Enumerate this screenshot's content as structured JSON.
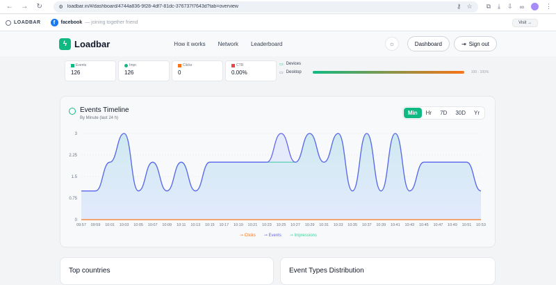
{
  "browser": {
    "url": "loadbar.in/#/dashboard/4744a836-9f28-4df7-81dc-376737f7643d?tab=overview"
  },
  "notification": {
    "brand": "LOADBAR",
    "source": "facebook",
    "message": "— joining together friend",
    "visit_label": "Visit →"
  },
  "header": {
    "logo": "Loadbar",
    "nav": [
      "How it works",
      "Network",
      "Leaderboard"
    ],
    "dashboard_label": "Dashboard",
    "signout_label": "Sign out"
  },
  "stats": [
    {
      "label": "Events",
      "value": "126",
      "color": "#10b981"
    },
    {
      "label": "Impr.",
      "value": "126",
      "color": "#10b981"
    },
    {
      "label": "Clicks",
      "value": "0",
      "color": "#f97316"
    },
    {
      "label": "CTR",
      "value": "0.00%",
      "color": "#ef4444"
    }
  ],
  "devices": {
    "title": "Devices",
    "rows": [
      {
        "name": "Desktop",
        "range": "100 - 100%",
        "percent": 100
      }
    ]
  },
  "timeline": {
    "title": "Events Timeline",
    "subtitle": "By Minute (last 24 h)",
    "ranges": [
      "Min",
      "Hr",
      "7D",
      "30D",
      "Yr"
    ],
    "active_range": "Min"
  },
  "chart_data": {
    "type": "area",
    "x": [
      "09:57",
      "09:59",
      "10:01",
      "10:03",
      "10:05",
      "10:07",
      "10:09",
      "10:11",
      "10:13",
      "10:15",
      "10:17",
      "10:19",
      "10:21",
      "10:23",
      "10:25",
      "10:27",
      "10:29",
      "10:31",
      "10:33",
      "10:35",
      "10:37",
      "10:39",
      "10:41",
      "10:43",
      "10:45",
      "10:47",
      "10:49",
      "10:51",
      "10:53"
    ],
    "yticks": [
      "0",
      "0.75",
      "1.5",
      "2.25",
      "3"
    ],
    "ylim": [
      0,
      3
    ],
    "series": [
      {
        "name": "Clicks",
        "color": "#f97316",
        "values": [
          0,
          0,
          0,
          0,
          0,
          0,
          0,
          0,
          0,
          0,
          0,
          0,
          0,
          0,
          0,
          0,
          0,
          0,
          0,
          0,
          0,
          0,
          0,
          0,
          0,
          0,
          0,
          0,
          0
        ]
      },
      {
        "name": "Events",
        "color": "#6366f1",
        "values": [
          1,
          1,
          2,
          3,
          1,
          2,
          1,
          2,
          1,
          2,
          2,
          2,
          2,
          2,
          3,
          2,
          3,
          2,
          3,
          1,
          3,
          1,
          3,
          1,
          2,
          2,
          2,
          2,
          1
        ]
      },
      {
        "name": "Impressions",
        "color": "#34d399",
        "values": [
          1,
          1,
          2,
          3,
          1,
          2,
          1,
          2,
          1,
          2,
          2,
          2,
          2,
          2,
          2,
          2,
          3,
          2,
          3,
          1,
          3,
          1,
          3,
          1,
          2,
          2,
          2,
          2,
          1
        ]
      }
    ]
  },
  "bottom": {
    "countries_title": "Top countries",
    "distribution_title": "Event Types Distribution"
  }
}
